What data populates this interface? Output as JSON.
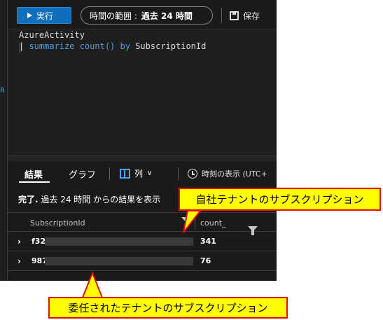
{
  "toolbar": {
    "run_label": "実行",
    "time_range_label": "時間の範囲 :",
    "time_range_value": "過去 24 時間",
    "save_label": "保存"
  },
  "editor": {
    "line1": "AzureActivity",
    "line2_pipe": "| ",
    "line2_kw1": "summarize count()",
    "line2_kw2": "by",
    "line2_rest": "SubscriptionId"
  },
  "left_strip": {
    "glyph": "R"
  },
  "results": {
    "tabs": {
      "results": "結果",
      "chart": "グラフ"
    },
    "columns_label": "列",
    "time_format_label": "時刻の表示 (UTC+",
    "status_bold": "完了.",
    "status_text": " 過去 24 時間 からの結果を表示",
    "headers": {
      "subscription": "SubscriptionId",
      "count": "count_"
    },
    "rows": [
      {
        "subscription": "f32",
        "count": "341"
      },
      {
        "subscription": "987",
        "count": "76"
      }
    ]
  },
  "callouts": {
    "own_tenant": "自社テナントのサブスクリプション",
    "delegated_tenant": "委任されたテナントのサブスクリプション"
  },
  "colors": {
    "accent": "#106ebe",
    "callout_fill": "#ffff00",
    "callout_border": "#e01010",
    "keyword": "#569cd6"
  }
}
